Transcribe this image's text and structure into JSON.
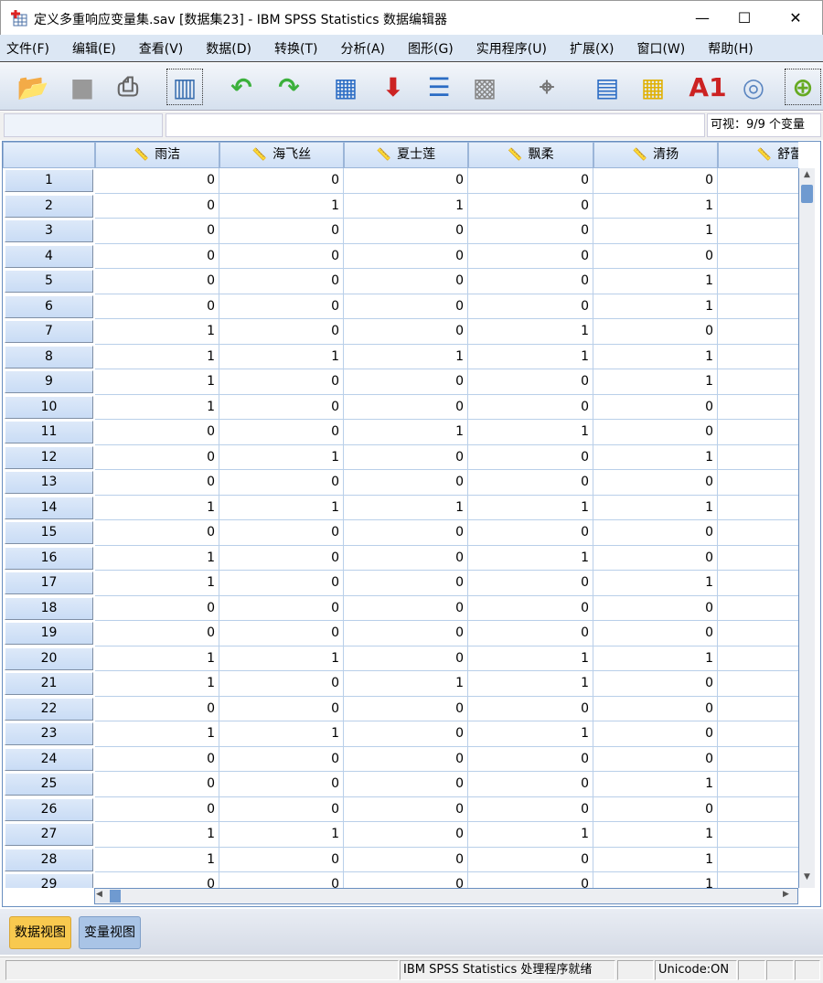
{
  "window": {
    "title": "定义多重响应变量集.sav [数据集23] - IBM SPSS Statistics 数据编辑器",
    "minimize": "—",
    "maximize": "☐",
    "close": "✕"
  },
  "menu": [
    "文件(F)",
    "编辑(E)",
    "查看(V)",
    "数据(D)",
    "转换(T)",
    "分析(A)",
    "图形(G)",
    "实用程序(U)",
    "扩展(X)",
    "窗口(W)",
    "帮助(H)"
  ],
  "toolbar": [
    "open-folder-icon",
    "save-disk-icon",
    "print-icon",
    "recall-dialog-icon",
    "undo-icon",
    "redo-icon",
    "goto-case-icon",
    "goto-variable-icon",
    "variables-icon",
    "run-descriptives-icon",
    "find-binoculars-icon",
    "split-file-icon",
    "select-cases-icon",
    "value-labels-icon",
    "use-variable-sets-icon",
    "show-all-variables-icon"
  ],
  "editor": {
    "cell_name": "",
    "cell_value": "",
    "visible": "可视：9/9 个变量"
  },
  "columns": [
    "雨洁",
    "海飞丝",
    "夏士莲",
    "飘柔",
    "清扬",
    "舒蕾"
  ],
  "rows": [
    [
      0,
      0,
      0,
      0,
      0
    ],
    [
      0,
      1,
      1,
      0,
      1
    ],
    [
      0,
      0,
      0,
      0,
      1
    ],
    [
      0,
      0,
      0,
      0,
      0
    ],
    [
      0,
      0,
      0,
      0,
      1
    ],
    [
      0,
      0,
      0,
      0,
      1
    ],
    [
      1,
      0,
      0,
      1,
      0
    ],
    [
      1,
      1,
      1,
      1,
      1
    ],
    [
      1,
      0,
      0,
      0,
      1
    ],
    [
      1,
      0,
      0,
      0,
      0
    ],
    [
      0,
      0,
      1,
      1,
      0
    ],
    [
      0,
      1,
      0,
      0,
      1
    ],
    [
      0,
      0,
      0,
      0,
      0
    ],
    [
      1,
      1,
      1,
      1,
      1
    ],
    [
      0,
      0,
      0,
      0,
      0
    ],
    [
      1,
      0,
      0,
      1,
      0
    ],
    [
      1,
      0,
      0,
      0,
      1
    ],
    [
      0,
      0,
      0,
      0,
      0
    ],
    [
      0,
      0,
      0,
      0,
      0
    ],
    [
      1,
      1,
      0,
      1,
      1
    ],
    [
      1,
      0,
      1,
      1,
      0
    ],
    [
      0,
      0,
      0,
      0,
      0
    ],
    [
      1,
      1,
      0,
      1,
      0
    ],
    [
      0,
      0,
      0,
      0,
      0
    ],
    [
      0,
      0,
      0,
      0,
      1
    ],
    [
      0,
      0,
      0,
      0,
      0
    ],
    [
      1,
      1,
      0,
      1,
      1
    ],
    [
      1,
      0,
      0,
      0,
      1
    ],
    [
      0,
      0,
      0,
      0,
      1
    ]
  ],
  "tabs": {
    "data_view": "数据视图",
    "variable_view": "变量视图",
    "active": "data_view",
    "active_color": "#f8c94f"
  },
  "status": {
    "processor": "IBM SPSS Statistics 处理程序就绪",
    "unicode": "Unicode:ON"
  }
}
